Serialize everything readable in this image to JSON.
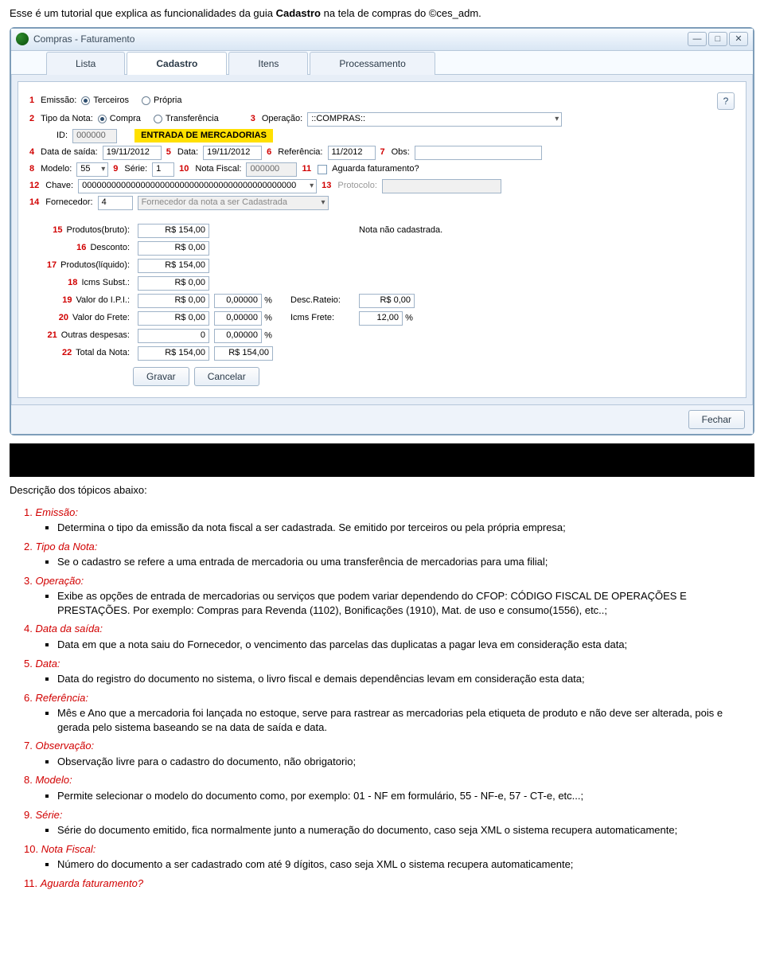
{
  "intro": {
    "pre": "Esse é um tutorial que explica as funcionalidades da guia ",
    "bold": "Cadastro",
    "post": " na tela de compras do ©ces_adm."
  },
  "window": {
    "title": "Compras - Faturamento",
    "btn_min": "—",
    "btn_max": "□",
    "btn_close": "✕",
    "tabs": {
      "lista": "Lista",
      "cadastro": "Cadastro",
      "itens": "Itens",
      "proc": "Processamento"
    },
    "help": "?",
    "labels": {
      "emissao": "Emissão:",
      "terceiros": "Terceiros",
      "propria": "Própria",
      "tipo_nota": "Tipo da Nota:",
      "compra": "Compra",
      "transf": "Transferência",
      "operacao": "Operação:",
      "operacao_val": "::COMPRAS::",
      "id": "ID:",
      "id_val": "000000",
      "banner": "ENTRADA DE MERCADORIAS",
      "data_saida": "Data de saída:",
      "data_saida_val": "19/11/2012",
      "data": "Data:",
      "data_val": "19/11/2012",
      "ref": "Referência:",
      "ref_val": "11/2012",
      "obs": "Obs:",
      "modelo": "Modelo:",
      "modelo_val": "55",
      "serie": "Série:",
      "serie_val": "1",
      "nota_fiscal": "Nota Fiscal:",
      "nota_fiscal_val": "000000",
      "aguarda": "Aguarda faturamento?",
      "chave": "Chave:",
      "chave_val": "00000000000000000000000000000000000000000000",
      "protocolo": "Protocolo:",
      "fornecedor": "Fornecedor:",
      "fornecedor_id": "4",
      "fornecedor_nome": "Fornecedor da nota a ser Cadastrada",
      "nota_nao": "Nota não cadastrada.",
      "n1": "1",
      "n2": "2",
      "n3": "3",
      "n4": "4",
      "n5": "5",
      "n6": "6",
      "n7": "7",
      "n8": "8",
      "n9": "9",
      "n10": "10",
      "n11": "11",
      "n12": "12",
      "n13": "13",
      "n14": "14"
    },
    "sum": {
      "n15": "15",
      "n16": "16",
      "n17": "17",
      "n18": "18",
      "n19": "19",
      "n20": "20",
      "n21": "21",
      "n22": "22",
      "produtos_bruto": "Produtos(bruto):",
      "v_produtos_bruto": "R$ 154,00",
      "desconto": "Desconto:",
      "v_desconto": "R$ 0,00",
      "produtos_liq": "Produtos(líquido):",
      "v_produtos_liq": "R$ 154,00",
      "icms_subst": "Icms Subst.:",
      "v_icms_subst": "R$ 0,00",
      "valor_ipi": "Valor do I.P.I.:",
      "v_valor_ipi": "R$ 0,00",
      "pct_ipi": "0,00000",
      "pct_sym": "%",
      "desc_rateio": "Desc.Rateio:",
      "v_desc_rateio": "R$ 0,00",
      "valor_frete": "Valor do Frete:",
      "v_valor_frete": "R$ 0,00",
      "pct_frete": "0,00000",
      "icms_frete": "Icms Frete:",
      "v_icms_frete": "12,00",
      "outras": "Outras despesas:",
      "v_outras": "0",
      "pct_outras": "0,00000",
      "total": "Total da Nota:",
      "v_total1": "R$ 154,00",
      "v_total2": "R$ 154,00"
    },
    "actions": {
      "gravar": "Gravar",
      "cancelar": "Cancelar",
      "fechar": "Fechar"
    }
  },
  "section_title": "Descrição dos tópicos abaixo:",
  "topics": [
    {
      "n": "1.",
      "title": "Emissão:",
      "items": [
        "Determina o tipo da emissão da nota fiscal a ser cadastrada. Se emitido por terceiros ou pela própria empresa;"
      ]
    },
    {
      "n": "2.",
      "title": "Tipo da Nota:",
      "items": [
        "Se o cadastro se refere a uma entrada de mercadoria ou uma transferência de mercadorias para uma filial;"
      ]
    },
    {
      "n": "3.",
      "title": "Operação:",
      "items": [
        "Exibe as opções de entrada de mercadorias ou serviços que podem variar dependendo do CFOP: CÓDIGO FISCAL DE OPERAÇÕES E PRESTAÇÕES.                                                          Por exemplo: Compras para Revenda (1102), Bonificações (1910), Mat. de uso e consumo(1556), etc..;"
      ]
    },
    {
      "n": "4.",
      "title": "Data da saída:",
      "items": [
        "Data em que a nota saiu do Fornecedor, o vencimento das parcelas das duplicatas a pagar leva em consideração esta data;"
      ]
    },
    {
      "n": "5.",
      "title": "Data:",
      "items": [
        "Data do registro do documento no sistema, o livro fiscal e demais dependências levam em consideração esta data;"
      ]
    },
    {
      "n": "6.",
      "title": "Referência:",
      "items": [
        "Mês e Ano que a mercadoria foi lançada no estoque, serve para rastrear as mercadorias pela etiqueta de produto e não deve ser alterada, pois e gerada pelo sistema baseando se na data de saída e data."
      ]
    },
    {
      "n": "7.",
      "title": "Observação:",
      "items": [
        "Observação livre para o cadastro do documento, não obrigatorio;"
      ]
    },
    {
      "n": "8.",
      "title": "Modelo:",
      "items": [
        "Permite selecionar o modelo do documento como, por exemplo: 01 - NF em formulário, 55 - NF-e, 57 - CT-e, etc...;"
      ]
    },
    {
      "n": "9.",
      "title": "Série:",
      "items": [
        "Série do documento emitido, fica normalmente junto a numeração do documento, caso seja XML o sistema recupera automaticamente;"
      ]
    },
    {
      "n": "10.",
      "title": "Nota Fiscal:",
      "items": [
        "Número do documento a ser cadastrado com até 9 dígitos, caso seja XML o sistema recupera automaticamente;"
      ]
    },
    {
      "n": "11.",
      "title": "Aguarda faturamento?",
      "items": []
    }
  ]
}
